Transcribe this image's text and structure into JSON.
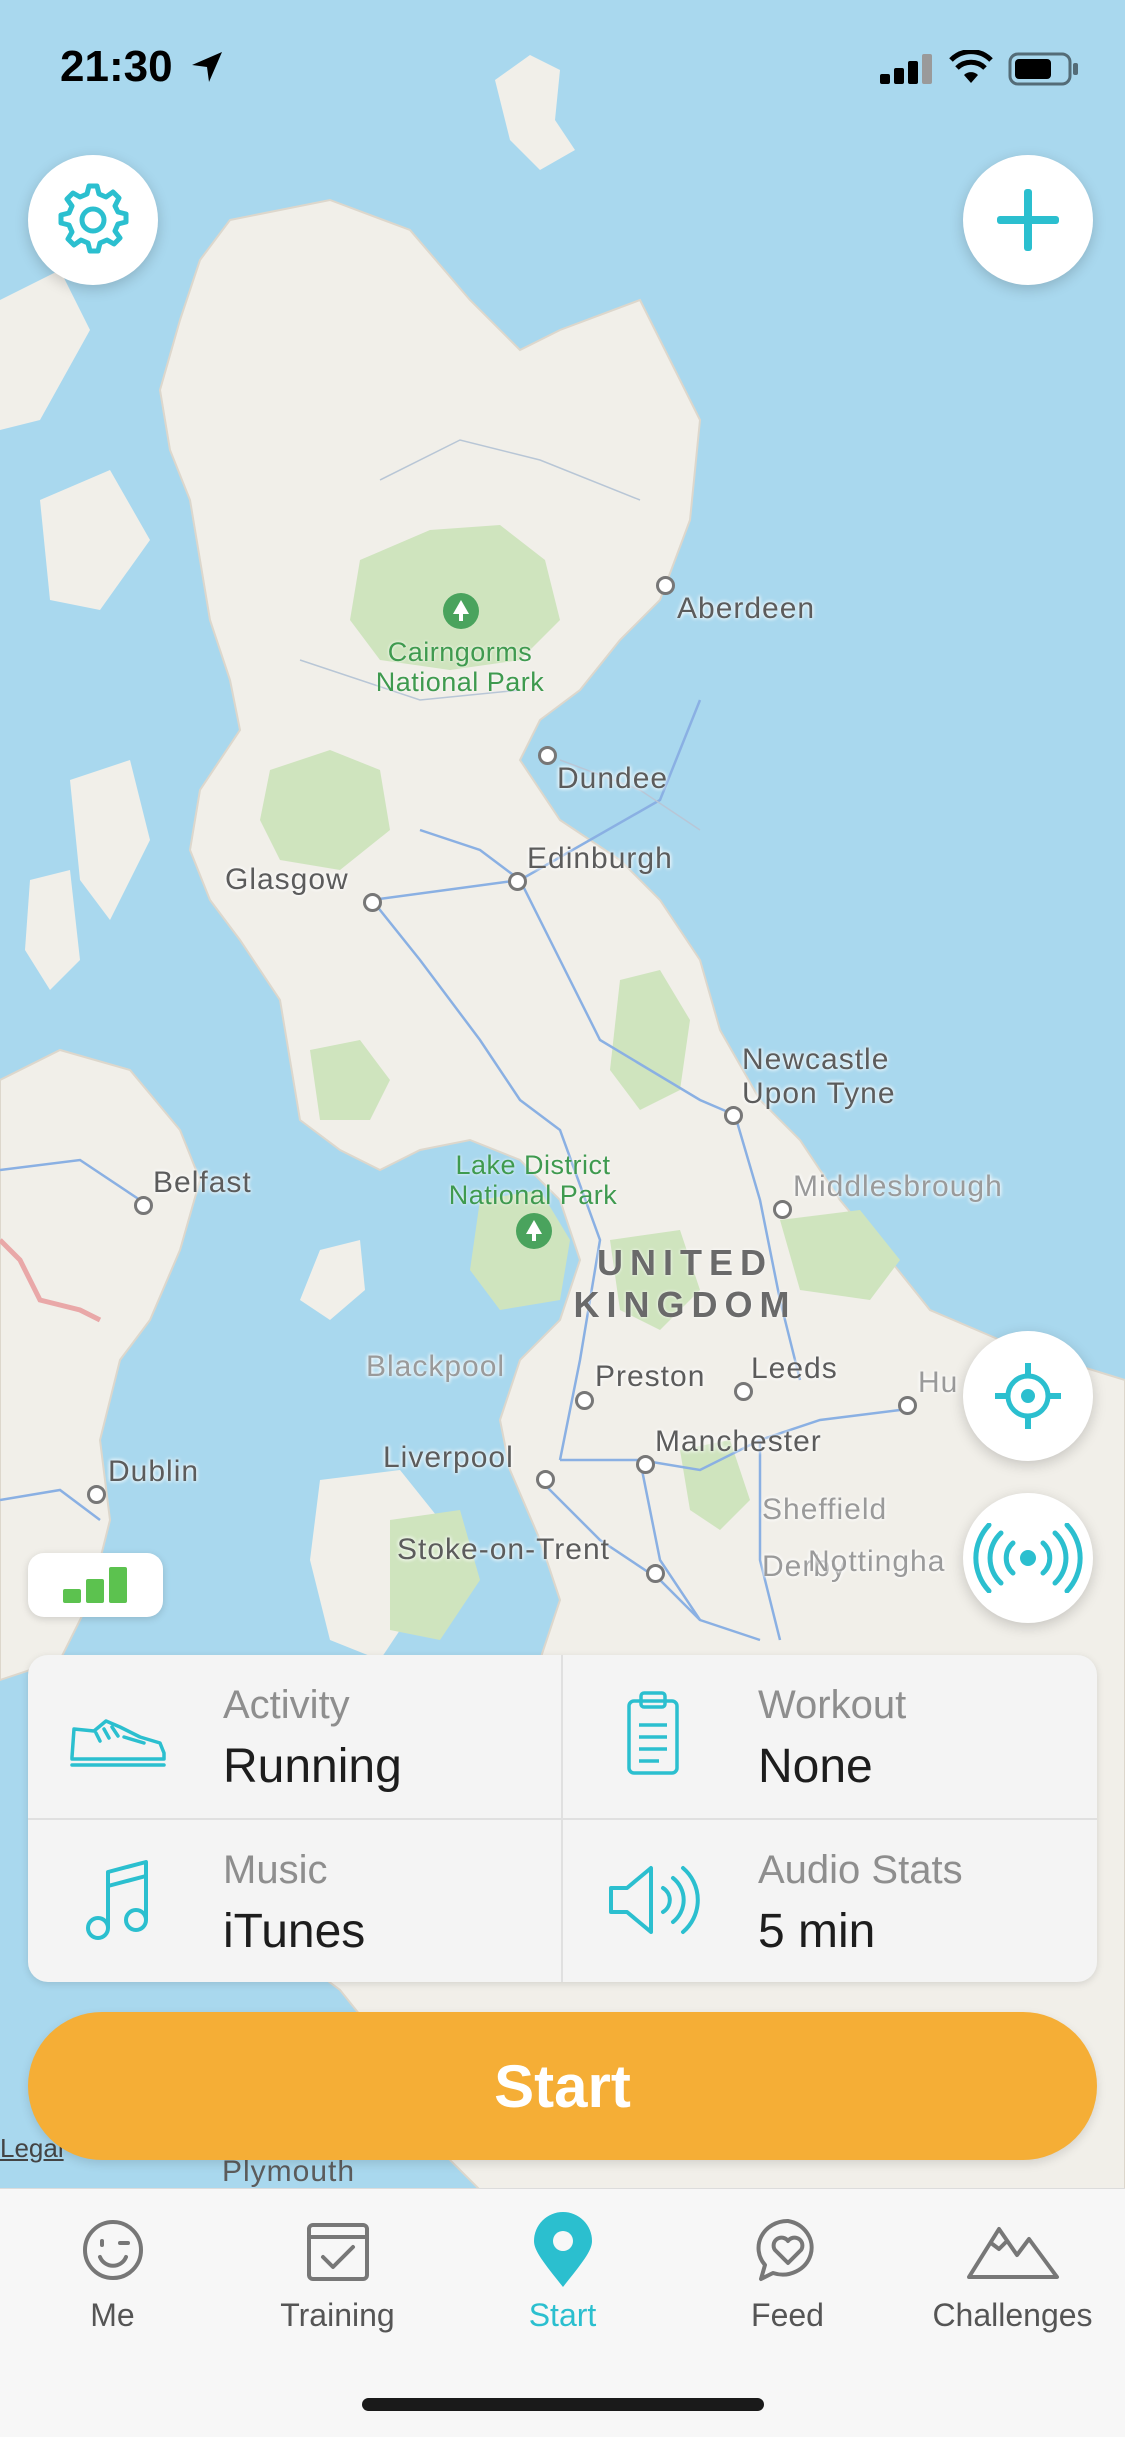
{
  "status_bar": {
    "time": "21:30"
  },
  "map": {
    "places": [
      {
        "name": "Aberdeen",
        "faded": false
      },
      {
        "name": "Dundee",
        "faded": false
      },
      {
        "name": "Edinburgh",
        "faded": false
      },
      {
        "name": "Glasgow",
        "faded": false
      },
      {
        "name": "Newcastle Upon Tyne",
        "faded": false
      },
      {
        "name": "Belfast",
        "faded": false
      },
      {
        "name": "Middlesbrough",
        "faded": true
      },
      {
        "name": "Blackpool",
        "faded": true
      },
      {
        "name": "Preston",
        "faded": false
      },
      {
        "name": "Leeds",
        "faded": false
      },
      {
        "name": "Hu",
        "faded": true
      },
      {
        "name": "Liverpool",
        "faded": false
      },
      {
        "name": "Manchester",
        "faded": false
      },
      {
        "name": "Dublin",
        "faded": false
      },
      {
        "name": "Sheffield",
        "faded": true
      },
      {
        "name": "Stoke-on-Trent",
        "faded": false
      },
      {
        "name": "Derby",
        "faded": true
      },
      {
        "name": "Nottingha",
        "faded": true
      },
      {
        "name": "Plymouth",
        "faded": false
      }
    ],
    "parks": [
      {
        "line1": "Cairngorms",
        "line2": "National Park"
      },
      {
        "line1": "Lake District",
        "line2": "National Park"
      }
    ],
    "country": {
      "line1": "UNITED",
      "line2": "KINGDOM"
    },
    "legal_link": "Legal"
  },
  "buttons": {
    "settings_icon": "gear-icon",
    "add_icon": "plus-icon",
    "locate_icon": "crosshair-icon",
    "broadcast_icon": "broadcast-icon",
    "signal_icon": "signal-strength-icon"
  },
  "options": {
    "activity": {
      "label": "Activity",
      "value": "Running",
      "icon": "shoe-icon"
    },
    "workout": {
      "label": "Workout",
      "value": "None",
      "icon": "clipboard-icon"
    },
    "music": {
      "label": "Music",
      "value": "iTunes",
      "icon": "music-note-icon"
    },
    "audio_stats": {
      "label": "Audio Stats",
      "value": "5 min",
      "icon": "speaker-icon"
    }
  },
  "start_button": {
    "label": "Start"
  },
  "tabs": [
    {
      "label": "Me",
      "icon": "smiley-icon"
    },
    {
      "label": "Training",
      "icon": "calendar-check-icon"
    },
    {
      "label": "Start",
      "icon": "map-pin-icon",
      "active": true
    },
    {
      "label": "Feed",
      "icon": "heart-bubble-icon"
    },
    {
      "label": "Challenges",
      "icon": "mountain-icon"
    }
  ],
  "colors": {
    "accent": "#2bbfcf",
    "start_orange": "#f5ae36",
    "water": "#a9d8ee",
    "land": "#f1efe9",
    "park": "#cfe4be"
  }
}
